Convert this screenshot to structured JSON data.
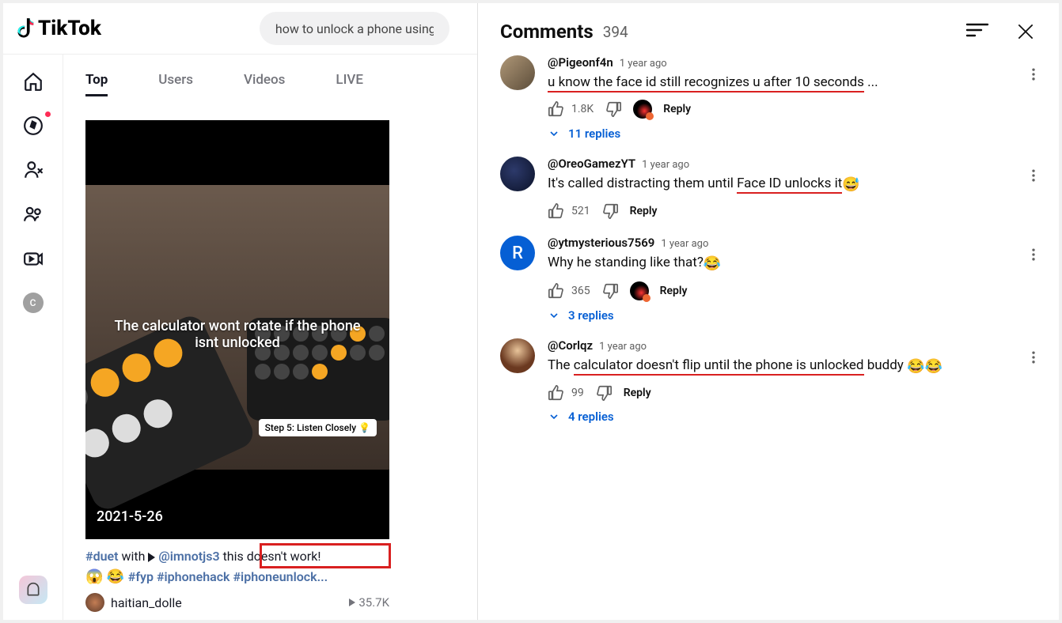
{
  "brand": "TikTok",
  "search": {
    "value": "how to unlock a phone using"
  },
  "sidebar": {
    "avatar_letter": "C"
  },
  "tabs": {
    "top": "Top",
    "users": "Users",
    "videos": "Videos",
    "live": "LIVE"
  },
  "video": {
    "overlay_text": "The calculator wont rotate if the phone isnt unlocked",
    "step_badge": "Step 5: Listen Closely 💡",
    "date": "2021-5-26",
    "caption_hash_duet": "#duet",
    "caption_with": " with ",
    "caption_at": " @imnotjs3 ",
    "caption_plain": " this doesn't work!",
    "caption_line2_hash1": "#fyp",
    "caption_line2_hash2": "#iphonehack",
    "caption_line2_hash3": "#iphoneunlock...",
    "username": "haitian_dolle",
    "views": "35.7K"
  },
  "comments_header": {
    "title": "Comments",
    "count": "394"
  },
  "comments": [
    {
      "author": "@Pigeonf4n",
      "time": "1 year ago",
      "text_underlined": "u know the face id still recognizes u after 10 seconds",
      "text_suffix": " ...",
      "has_underline": true,
      "trail_emoji": "",
      "likes": "1.8K",
      "show_mini_av": true,
      "replies": "11 replies",
      "avatar_class": "av-tiger",
      "avatar_letter": ""
    },
    {
      "author": "@OreoGamezYT",
      "time": "1 year ago",
      "text_prefix": "It's called distracting them until ",
      "text_underlined": "Face ID unlocks it",
      "has_underline": true,
      "trail_emoji": "😅",
      "likes": "521",
      "show_mini_av": false,
      "replies": "",
      "avatar_class": "av-oreo",
      "avatar_letter": ""
    },
    {
      "author": "@ytmysterious7569",
      "time": "1 year ago",
      "text_plain": "Why he standing like that?",
      "has_underline": false,
      "trail_emoji": "😂",
      "likes": "365",
      "show_mini_av": true,
      "replies": "3 replies",
      "avatar_class": "av-blue",
      "avatar_letter": "R"
    },
    {
      "author": "@Corlqz",
      "time": "1 year ago",
      "text_prefix": "The ",
      "text_underlined": "calculator doesn't flip until the phone is unlocked",
      "text_suffix": " buddy ",
      "has_underline": true,
      "trail_emoji": "😂😂",
      "likes": "99",
      "show_mini_av": false,
      "replies": "4 replies",
      "avatar_class": "av-luffy",
      "avatar_letter": ""
    }
  ],
  "reply_label": "Reply"
}
